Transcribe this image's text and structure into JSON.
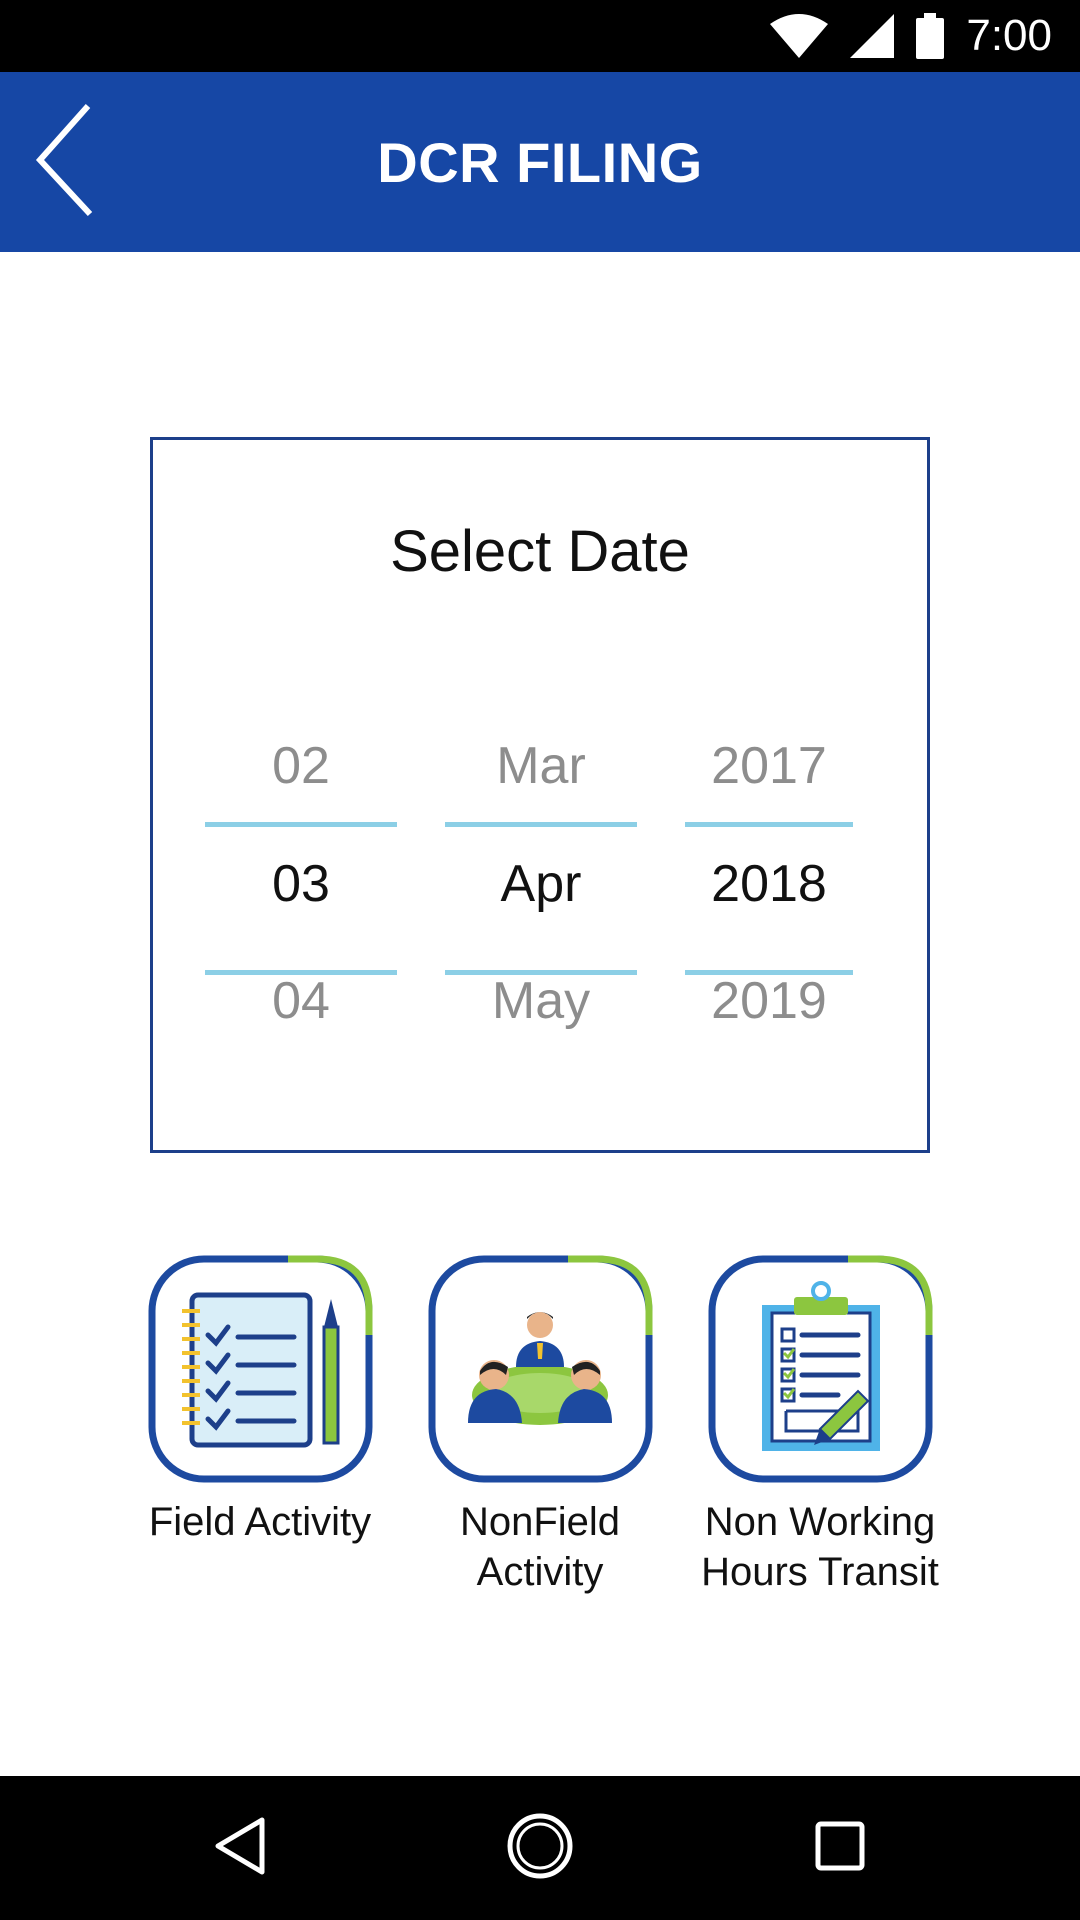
{
  "status_bar": {
    "time": "7:00",
    "icons": [
      "wifi-icon",
      "cell-signal-icon",
      "battery-icon"
    ]
  },
  "app_bar": {
    "title": "DCR FILING",
    "back_icon": "back-chevron-icon",
    "background": "#1647a5"
  },
  "date_picker": {
    "title": "Select Date",
    "day": {
      "prev": "02",
      "selected": "03",
      "next": "04"
    },
    "month": {
      "prev": "Mar",
      "selected": "Apr",
      "next": "May"
    },
    "year": {
      "prev": "2017",
      "selected": "2018",
      "next": "2019"
    },
    "divider_color": "#8ccfe6",
    "border_color": "#1d3f8a"
  },
  "activities": [
    {
      "label": "Field Activity",
      "icon": "notebook-checklist-icon"
    },
    {
      "label": "NonField\nActivity",
      "icon": "meeting-people-icon"
    },
    {
      "label": "Non Working\nHours Transit",
      "icon": "clipboard-checklist-icon"
    }
  ],
  "colors": {
    "tile_border": "#1d4aa0",
    "tile_accent": "#8cc63f"
  },
  "nav_bar": {
    "icons": [
      "back-triangle-icon",
      "home-circle-icon",
      "recents-square-icon"
    ]
  }
}
